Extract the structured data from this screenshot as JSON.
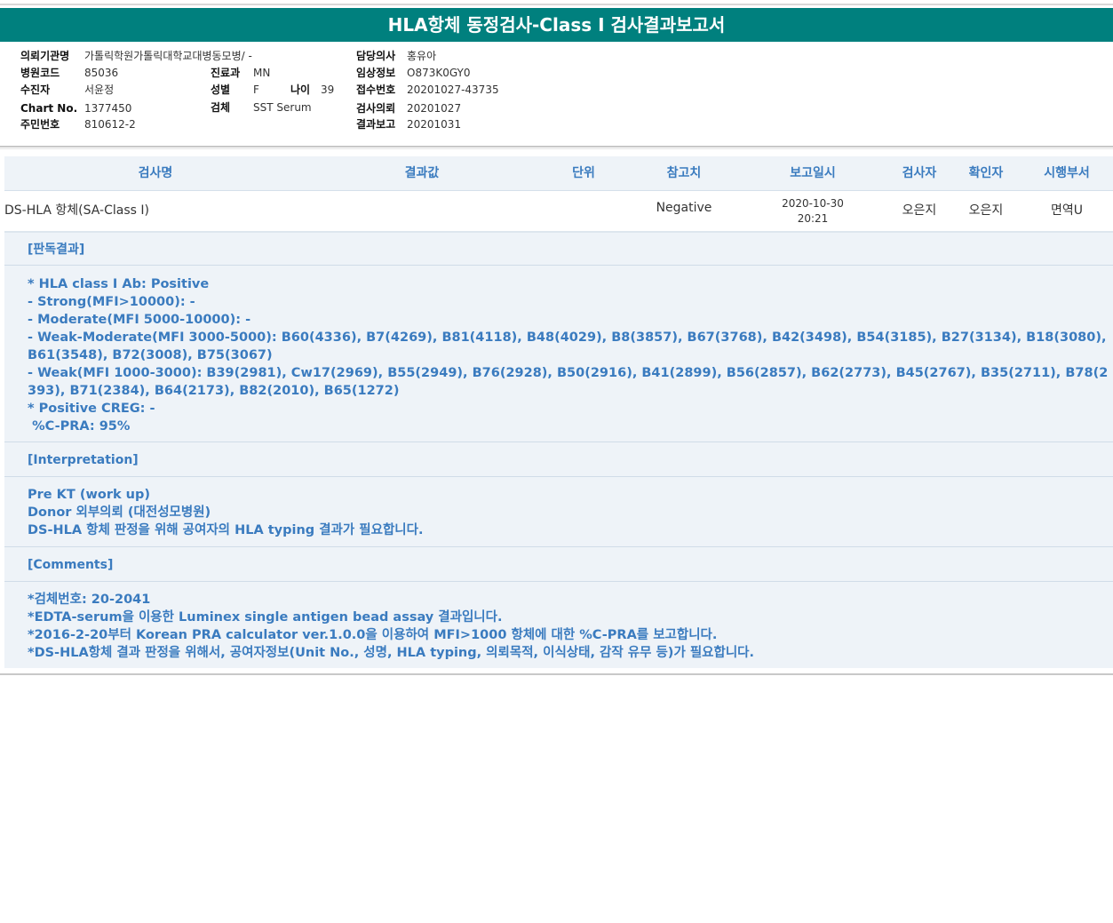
{
  "header": {
    "title": "HLA항체 동정검사-Class I 검사결과보고서"
  },
  "patient_info": {
    "col1": [
      {
        "label": "의뢰기관명",
        "value": "가톨릭학원가톨릭대학교대병동모병/ -"
      },
      {
        "label": "병원코드",
        "value": "85036"
      },
      {
        "label": "수진자",
        "value": "서윤정"
      },
      {
        "label": "Chart No.",
        "value": "1377450"
      },
      {
        "label": "주민번호",
        "value": "810612-2"
      }
    ],
    "col2": [
      {
        "label": "진료과",
        "value": "MN"
      },
      {
        "label": "성별",
        "value": "F"
      },
      {
        "label": "검체",
        "value": "SST Serum"
      }
    ],
    "age": {
      "label": "나이",
      "value": "39"
    },
    "col3": [
      {
        "label": "담당의사",
        "value": "홍유아"
      },
      {
        "label": "임상정보",
        "value": "O873K0GY0"
      },
      {
        "label": "접수번호",
        "value": "20201027-43735"
      },
      {
        "label": "검사의뢰",
        "value": "20201027"
      },
      {
        "label": "결과보고",
        "value": "20201031"
      }
    ]
  },
  "table": {
    "headers": [
      "검사명",
      "결과값",
      "단위",
      "참고치",
      "보고일시",
      "검사자",
      "확인자",
      "시행부서"
    ],
    "row": {
      "test_name": "DS-HLA 항체(SA-Class I)",
      "result": "",
      "unit": "",
      "reference": "Negative",
      "report_date": "2020-10-30",
      "report_time": "20:21",
      "tester": "오은지",
      "confirmer": "오은지",
      "department": "면역U"
    }
  },
  "sections": {
    "result_heading": "[판독결과]",
    "result_text": "* HLA class I Ab: Positive\n- Strong(MFI>10000): -\n- Moderate(MFI 5000-10000): -\n- Weak-Moderate(MFI 3000-5000): B60(4336), B7(4269), B81(4118), B48(4029), B8(3857), B67(3768), B42(3498), B54(3185), B27(3134), B18(3080), B61(3548), B72(3008), B75(3067)\n- Weak(MFI 1000-3000): B39(2981), Cw17(2969), B55(2949), B76(2928), B50(2916), B41(2899), B56(2857), B62(2773), B45(2767), B35(2711), B78(2393), B71(2384), B64(2173), B82(2010), B65(1272)\n* Positive CREG: -\n %C-PRA: 95%",
    "interp_heading": "[Interpretation]",
    "interp_text": "Pre KT (work up)\nDonor 외부의뢰 (대전성모병원)\nDS-HLA 항체 판정을 위해 공여자의 HLA typing 결과가 필요합니다.",
    "comments_heading": "[Comments]",
    "comments_text": "*검체번호: 20-2041\n*EDTA-serum을 이용한 Luminex single antigen bead assay 결과입니다.\n*2016-2-20부터 Korean PRA calculator ver.1.0.0을 이용하여 MFI>1000 항체에 대한 %C-PRA를 보고합니다.\n*DS-HLA항체 결과 판정을 위해서, 공여자정보(Unit No., 성명, HLA typing, 의뢰목적, 이식상태, 감작 유무 등)가 필요합니다."
  },
  "colors": {
    "title_bg": "#00807e",
    "accent_text": "#3a7bbf",
    "panel_bg": "#eef3f8"
  }
}
